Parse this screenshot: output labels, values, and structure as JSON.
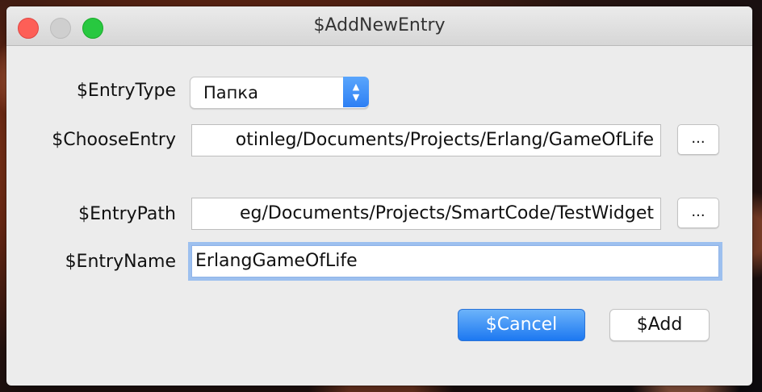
{
  "window": {
    "title": "$AddNewEntry"
  },
  "form": {
    "entry_type": {
      "label": "$EntryType",
      "selected": "Папка"
    },
    "choose_entry": {
      "label": "$ChooseEntry",
      "value": "otinleg/Documents/Projects/Erlang/GameOfLife",
      "browse_label": "..."
    },
    "entry_path": {
      "label": "$EntryPath",
      "value": "eg/Documents/Projects/SmartCode/TestWidget",
      "browse_label": "..."
    },
    "entry_name": {
      "label": "$EntryName",
      "value": "ErlangGameOfLife"
    }
  },
  "buttons": {
    "cancel": "$Cancel",
    "add": "$Add"
  }
}
